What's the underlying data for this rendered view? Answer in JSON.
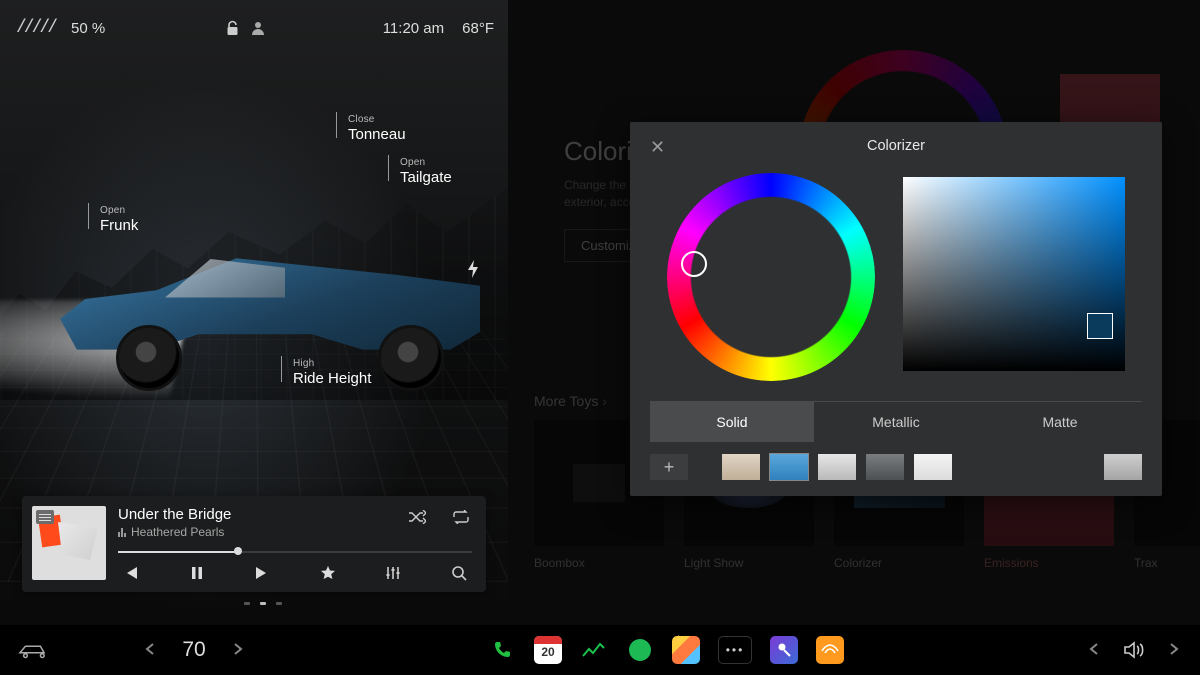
{
  "status": {
    "battery_percent": "50 %",
    "time": "11:20 am",
    "temp_outside": "68°F"
  },
  "callouts": {
    "tonneau": {
      "caption": "Close",
      "label": "Tonneau"
    },
    "tailgate": {
      "caption": "Open",
      "label": "Tailgate"
    },
    "frunk": {
      "caption": "Open",
      "label": "Frunk"
    },
    "ride": {
      "caption": "High",
      "label": "Ride Height"
    }
  },
  "media": {
    "track": "Under the Bridge",
    "artist": "Heathered Pearls"
  },
  "toybox": {
    "title": "Colorizer",
    "blurb_l1": "Change the color of your Cybertruck. Includes",
    "blurb_l2": "exterior, accent and wheel options.",
    "customize": "Customize",
    "more": "More Toys",
    "tiles": {
      "boombox": "Boombox",
      "lightshow": "Light Show",
      "colorizer": "Colorizer",
      "emissions": "Emissions",
      "trax": "Trax"
    }
  },
  "modal": {
    "title": "Colorizer",
    "tabs": {
      "solid": "Solid",
      "metallic": "Metallic",
      "matte": "Matte"
    }
  },
  "dock": {
    "temp_cabin": "70",
    "calendar_day": "20"
  }
}
